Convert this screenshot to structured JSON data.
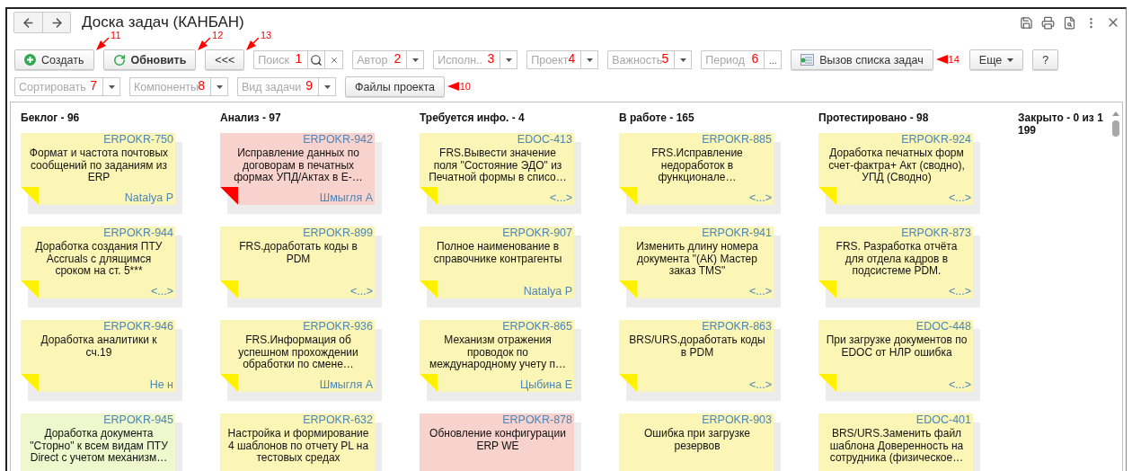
{
  "window": {
    "title": "Доска задач (КАНБАН)"
  },
  "toolbar": {
    "rows": [
      {
        "items": [
          {
            "kind": "create",
            "label": "Создать",
            "default": false,
            "callout": {
              "label": "11",
              "kind": "diagonal"
            }
          },
          {
            "kind": "refresh",
            "label": "Обновить",
            "default": true,
            "callout": {
              "label": "12",
              "kind": "diagonal"
            }
          },
          {
            "kind": "plain",
            "label": "<<<",
            "default": false,
            "callout": {
              "label": "13",
              "kind": "diagonal"
            }
          },
          {
            "kind": "search-field",
            "placeholder": "Поиск",
            "marker": "1"
          },
          {
            "kind": "dropdown-field",
            "placeholder": "Автор",
            "marker": "2"
          },
          {
            "kind": "dropdown-field",
            "placeholder": "Исполн..",
            "marker": "3"
          },
          {
            "kind": "dropdown-field",
            "placeholder": "Проект",
            "marker": "4"
          },
          {
            "kind": "dropdown-field",
            "placeholder": "Важность",
            "marker": "5"
          },
          {
            "kind": "choice-field",
            "placeholder": "Период",
            "marker": "6",
            "button_label": "..."
          },
          {
            "kind": "list",
            "label": "Вызов списка задач",
            "default": false,
            "callout": {
              "label": "14",
              "kind": "side"
            }
          },
          {
            "kind": "menu",
            "label": "Еще",
            "default": false
          },
          {
            "kind": "plain",
            "label": "?",
            "default": false
          }
        ]
      },
      {
        "items": [
          {
            "kind": "dropdown-field",
            "placeholder": "Сортировать",
            "marker": "7"
          },
          {
            "kind": "dropdown-field",
            "placeholder": "Компоненты",
            "marker": "8"
          },
          {
            "kind": "dropdown-field",
            "placeholder": "Вид задачи",
            "marker": "9"
          },
          {
            "kind": "plain",
            "label": "Файлы проекта",
            "default": false,
            "callout": {
              "label": "10",
              "kind": "side"
            }
          }
        ]
      }
    ]
  },
  "board": {
    "columns": [
      {
        "title": "Беклог - 96",
        "cards": [
          {
            "id": "ERPOKR-750",
            "title": "Формат и частота почтовых сообщений по заданиям из ERP",
            "footer": "Natalya P",
            "color": "#fbf6b5",
            "flag": {
              "color": "#fff200"
            }
          },
          {
            "id": "ERPOKR-944",
            "title": "Доработка создания ПТУ Accruals с длящимся сроком на ст. 5***",
            "footer": "<...>",
            "color": "#fbf6b5",
            "flag": {
              "color": "#fff200"
            }
          },
          {
            "id": "ERPOKR-946",
            "title": "Доработка аналитики к сч.19",
            "footer": "Не н",
            "color": "#fbf6b5",
            "flag": {
              "color": "#fff200"
            }
          },
          {
            "id": "ERPOKR-945",
            "title": "Доработка документа \"Сторно\" к всем видам ПТУ Direct с учетом механизм…",
            "color": "#eef8cc"
          }
        ]
      },
      {
        "title": "Анализ - 97",
        "cards": [
          {
            "id": "ERPOKR-942",
            "title": "Исправление данных по договорам в печатных формах УПД/Актах в Е-…",
            "footer": "Шмыгля А",
            "color": "#f8d3cd",
            "flag": {
              "color": "#ff0000"
            }
          },
          {
            "id": "ERPOKR-899",
            "title": "FRS.доработать коды в PDM",
            "footer": "<...>",
            "color": "#fbf6b5",
            "flag": {
              "color": "#fff200"
            }
          },
          {
            "id": "ERPOKR-936",
            "title": "FRS.Информация об успешном прохождении обработки по смене…",
            "footer": "Шмыгля А",
            "color": "#fbf6b5",
            "flag": {
              "color": "#fff200"
            }
          },
          {
            "id": "ERPOKR-632",
            "title": "Настройка и формирование 4 шаблонов по отчету PL на тестовых средах",
            "color": "#fbf6b5"
          }
        ]
      },
      {
        "title": "Требуется инфо. - 4",
        "cards": [
          {
            "id": "EDOC-413",
            "title": "FRS.Вывести значение поля \"Состояние ЭДО\" из Печатной формы в списо…",
            "footer": "<...>",
            "color": "#fbf6b5",
            "flag": {
              "color": "#fff200"
            }
          },
          {
            "id": "ERPOKR-907",
            "title": "Полное наименование в справочнике контрагенты",
            "footer": "Natalya P",
            "color": "#fbf6b5",
            "flag": {
              "color": "#fff200"
            }
          },
          {
            "id": "ERPOKR-865",
            "title": "Механизм отражения проводок по международному учету п…",
            "footer": "Цыбина Е",
            "color": "#fbf6b5",
            "flag": {
              "color": "#fff200"
            }
          },
          {
            "id": "ERPOKR-878",
            "title": "Обновление конфигурации ERP WE",
            "color": "#f8d3cd"
          }
        ]
      },
      {
        "title": "В работе - 165",
        "cards": [
          {
            "id": "ERPOKR-885",
            "title": "FRS.Исправление недоработок в функционале…",
            "footer": "<...>",
            "color": "#fbf6b5",
            "flag": {
              "color": "#fff200"
            }
          },
          {
            "id": "ERPOKR-941",
            "title": "Изменить длину номера документа \"(АК) Мастер заказ TMS\"",
            "footer": "<...>",
            "color": "#fbf6b5",
            "flag": {
              "color": "#fff200"
            }
          },
          {
            "id": "ERPOKR-863",
            "title": "BRS/URS.доработать коды в PDM",
            "footer": "<...>",
            "color": "#fbf6b5",
            "flag": {
              "color": "#fff200"
            }
          },
          {
            "id": "ERPOKR-903",
            "title": "Ошибка при загрузке резервов",
            "color": "#fbf6b5"
          }
        ]
      },
      {
        "title": "Протестировано - 98",
        "cards": [
          {
            "id": "ERPOKR-924",
            "title": "Доработка печатных форм счет-фактра+ Акт (сводно), УПД (Сводно)",
            "footer": "<...>",
            "color": "#fbf6b5",
            "flag": {
              "color": "#fff200"
            }
          },
          {
            "id": "ERPOKR-873",
            "title": "FRS. Разработка отчёта для отдела кадров в подсистеме PDM.",
            "footer": "<...>",
            "color": "#fbf6b5",
            "flag": {
              "color": "#fff200"
            }
          },
          {
            "id": "EDOC-448",
            "title": "При загрузке документов по EDOC от НЛР ошибка",
            "footer": "<...>",
            "color": "#fbf6b5",
            "flag": {
              "color": "#fff200"
            }
          },
          {
            "id": "EDOC-401",
            "title": "BRS/URS.Заменить файл шаблона Доверенность на сотрудника (физическое…",
            "color": "#fbf6b5"
          }
        ]
      },
      {
        "title": "Закрыто - 0 из 1 199"
      }
    ]
  }
}
